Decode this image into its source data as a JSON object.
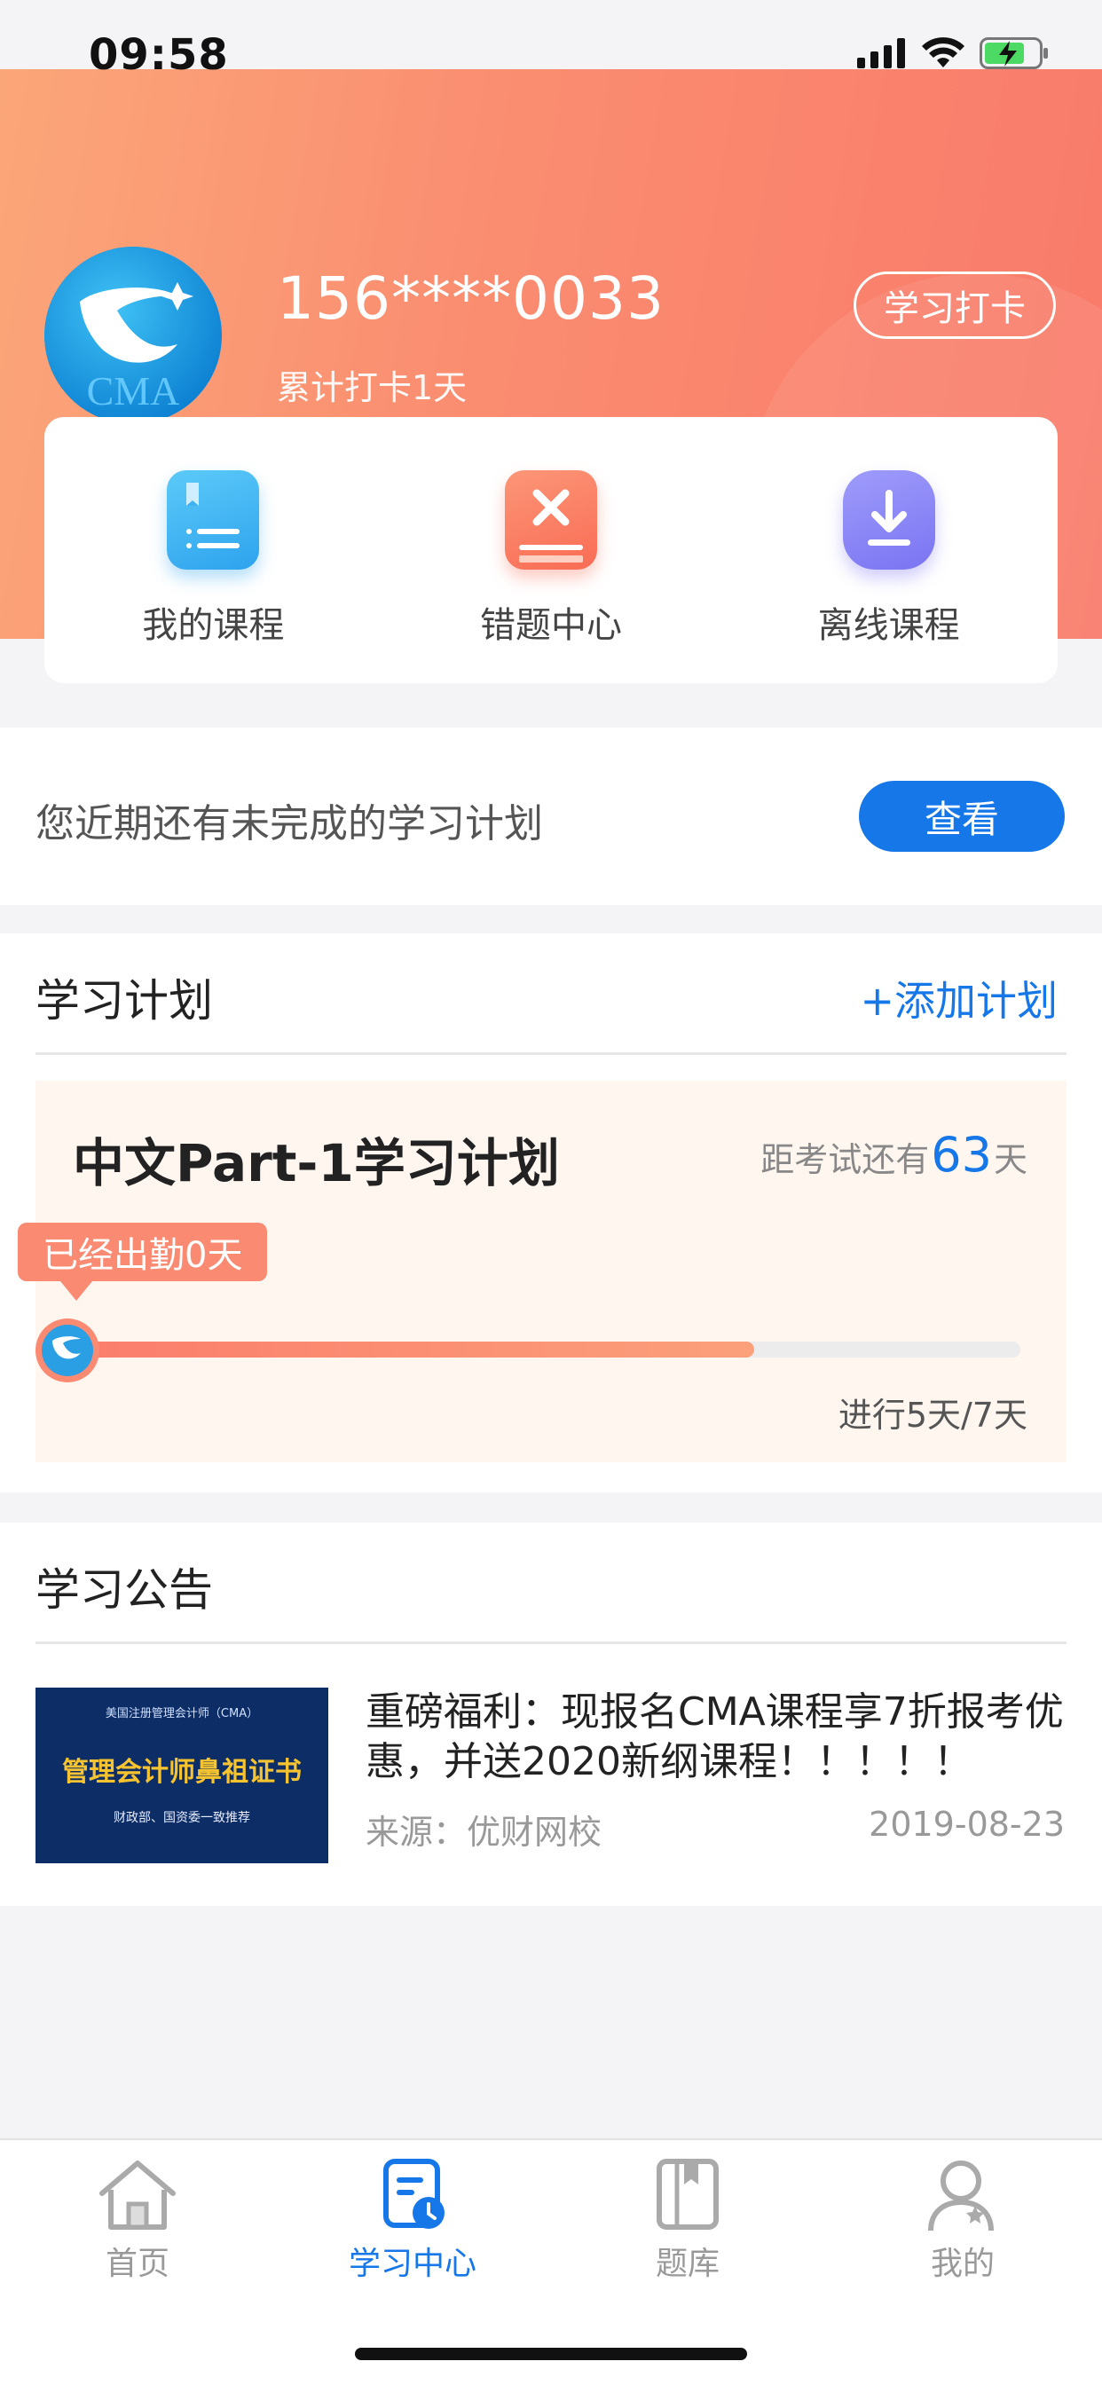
{
  "status_bar": {
    "time": "09:58"
  },
  "header": {
    "avatar_text": "CMA",
    "phone": "156****0033",
    "checkin_days": "累计打卡1天",
    "checkin_button": "学习打卡"
  },
  "quick_actions": [
    {
      "label": "我的课程",
      "icon": "book-icon",
      "color": "#3fb2f2"
    },
    {
      "label": "错题中心",
      "icon": "wrong-question-icon",
      "color": "#fb7d63"
    },
    {
      "label": "离线课程",
      "icon": "download-icon",
      "color": "#8a86f7"
    }
  ],
  "notice": {
    "text": "您近期还有未完成的学习计划",
    "button": "查看"
  },
  "study_plan": {
    "section_title": "学习计划",
    "add_link": "+添加计划",
    "plan_name": "中文Part-1学习计划",
    "exam_prefix": "距考试还有",
    "exam_days": "63",
    "exam_suffix": "天",
    "attendance": "已经出勤0天",
    "progress_fraction": 0.72,
    "progress_text": "进行5天/7天"
  },
  "announcements": {
    "section_title": "学习公告",
    "items": [
      {
        "thumb_top": "美国注册管理会计师（CMA）",
        "thumb_main": "管理会计师鼻祖证书",
        "thumb_sub": "财政部、国资委一致推荐",
        "title": "重磅福利：现报名CMA课程享7折报考优惠，并送2020新纲课程！！！！！",
        "source": "来源：优财网校",
        "date": "2019-08-23"
      }
    ]
  },
  "tabbar": {
    "tabs": [
      {
        "label": "首页",
        "icon": "home-icon"
      },
      {
        "label": "学习中心",
        "icon": "study-center-icon"
      },
      {
        "label": "题库",
        "icon": "question-bank-icon"
      },
      {
        "label": "我的",
        "icon": "profile-icon"
      }
    ],
    "active": "学习中心",
    "accent": "#1677e8"
  }
}
